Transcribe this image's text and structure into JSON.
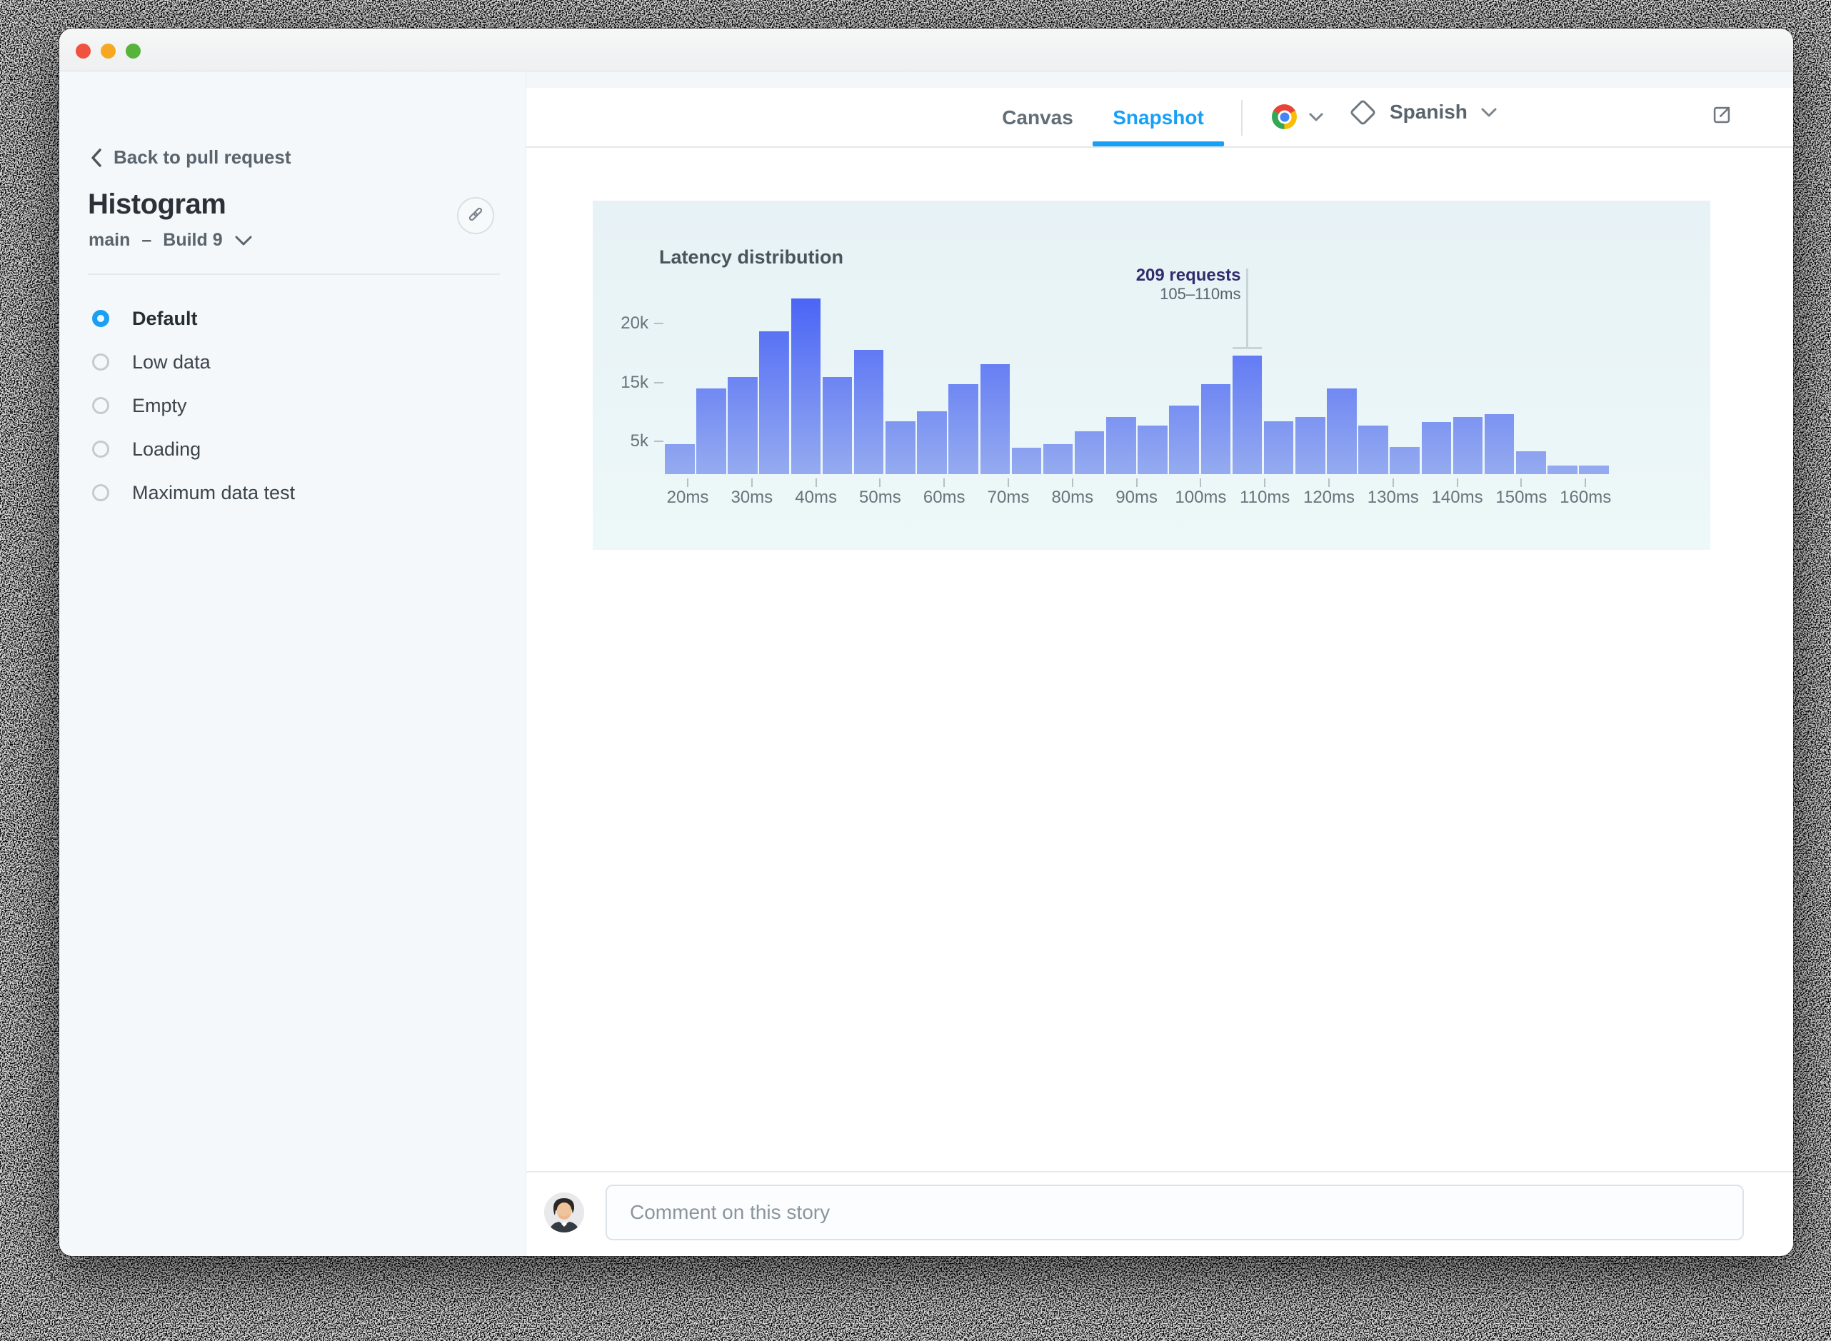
{
  "window": {
    "traffic_lights": [
      "close",
      "minimize",
      "zoom"
    ]
  },
  "sidebar": {
    "back_link": "Back to pull request",
    "story_title": "Histogram",
    "branch": "main",
    "dash": "–",
    "build": "Build 9",
    "stories": [
      {
        "label": "Default",
        "selected": true
      },
      {
        "label": "Low data",
        "selected": false
      },
      {
        "label": "Empty",
        "selected": false
      },
      {
        "label": "Loading",
        "selected": false
      },
      {
        "label": "Maximum data test",
        "selected": false
      }
    ]
  },
  "toolbar": {
    "tabs": [
      {
        "label": "Canvas",
        "active": false
      },
      {
        "label": "Snapshot",
        "active": true
      }
    ],
    "browser_icon": "chrome-icon",
    "locale_label": "Spanish"
  },
  "chart_data": {
    "type": "bar",
    "title": "Latency distribution",
    "xlabel": "",
    "ylabel": "",
    "x_unit": "ms",
    "bin_width_ms": 5,
    "first_bin_start_ms": 15,
    "x_tick_labels": [
      "20ms",
      "30ms",
      "40ms",
      "50ms",
      "60ms",
      "70ms",
      "80ms",
      "90ms",
      "100ms",
      "110ms",
      "120ms",
      "130ms",
      "140ms",
      "150ms",
      "160ms"
    ],
    "y_ticks": [
      {
        "label": "20k",
        "y": 172
      },
      {
        "label": "15k",
        "y": 255
      },
      {
        "label": "5k",
        "y": 337
      }
    ],
    "values_thousands": [
      4.9,
      14.1,
      16.0,
      23.5,
      28.9,
      16.0,
      20.5,
      8.7,
      10.4,
      14.8,
      18.1,
      4.4,
      4.9,
      7.1,
      9.4,
      8.0,
      11.3,
      14.8,
      19.5,
      8.7,
      9.4,
      14.1,
      8.0,
      4.5,
      8.6,
      9.4,
      9.9,
      3.8,
      1.4,
      1.4
    ],
    "annotation": {
      "label": "209 requests",
      "sublabel": "105–110ms",
      "bin_index": 18
    },
    "legend": false,
    "grid": false
  },
  "comment_bar": {
    "placeholder": "Comment on this story"
  },
  "colors": {
    "accent": "#1b9ff2",
    "bar_gradient_top": "#4560f6",
    "bar_gradient_bottom": "#95abf0",
    "annotation_text": "#322c6d",
    "panel_background": "#e9f4f8"
  }
}
